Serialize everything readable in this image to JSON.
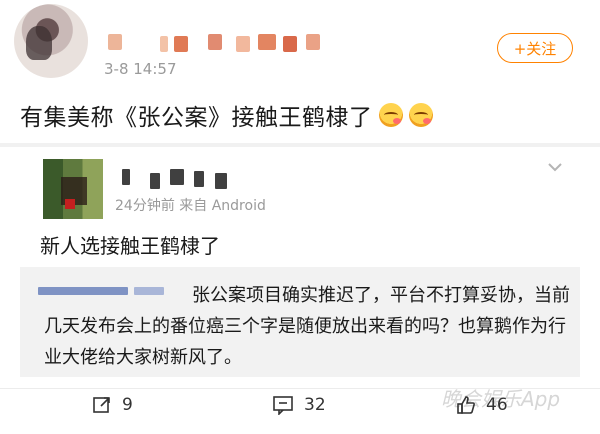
{
  "post": {
    "time": "3-8 14:57",
    "follow_label": "+关注",
    "text": "有集美称《张公案》接触王鹤棣了"
  },
  "repost": {
    "meta": "24分钟前  来自 Android",
    "text": "新人选接触王鹤棣了",
    "quote_text": "张公案项目确实推迟了，平台不打算妥协，当前几天发布会上的番位癌三个字是随便放出来看的吗？也算鹅作为行业大佬给大家树新风了。"
  },
  "watermark": "晚会娱乐App",
  "actions": {
    "repost_count": "9",
    "comment_count": "32",
    "like_count": "46"
  },
  "icons": {
    "repost": "share-icon",
    "comment": "comment-icon",
    "like": "thumb-up-icon",
    "chevron": "chevron-down-icon",
    "emoji": "drooling-face-emoji-icon"
  },
  "colors": {
    "accent": "#ff8200",
    "meta_text": "#9a9a9a",
    "quote_bg": "#f2f2f2"
  }
}
